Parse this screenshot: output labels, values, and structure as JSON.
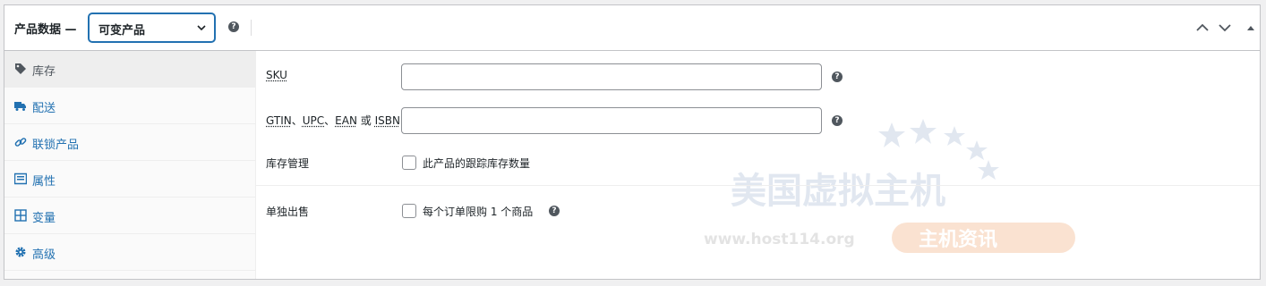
{
  "header": {
    "title": "产品数据 —",
    "product_type": "可变产品"
  },
  "sidebar": {
    "items": [
      {
        "label": "库存",
        "icon": "tag-icon"
      },
      {
        "label": "配送",
        "icon": "truck-icon"
      },
      {
        "label": "联锁产品",
        "icon": "link-icon"
      },
      {
        "label": "属性",
        "icon": "list-icon"
      },
      {
        "label": "变量",
        "icon": "grid-icon"
      },
      {
        "label": "高级",
        "icon": "gear-icon"
      }
    ]
  },
  "fields": {
    "sku_label": "SKU",
    "sku_value": "",
    "gtin_label_parts": [
      "GTIN",
      "、",
      "UPC",
      "、",
      "EAN",
      " 或 ",
      "ISBN"
    ],
    "gtin_value": "",
    "stock_mgmt_label": "库存管理",
    "stock_mgmt_checkbox": "此产品的跟踪库存数量",
    "sold_individually_label": "单独出售",
    "sold_individually_checkbox": "每个订单限购 1 个商品"
  },
  "watermark": {
    "title": "美国虚拟主机",
    "url": "www.host114.org",
    "tag": "主机资讯"
  },
  "colors": {
    "accent": "#2271b1",
    "text": "#1d2327",
    "muted": "#50575e",
    "border": "#c3c4c7"
  }
}
